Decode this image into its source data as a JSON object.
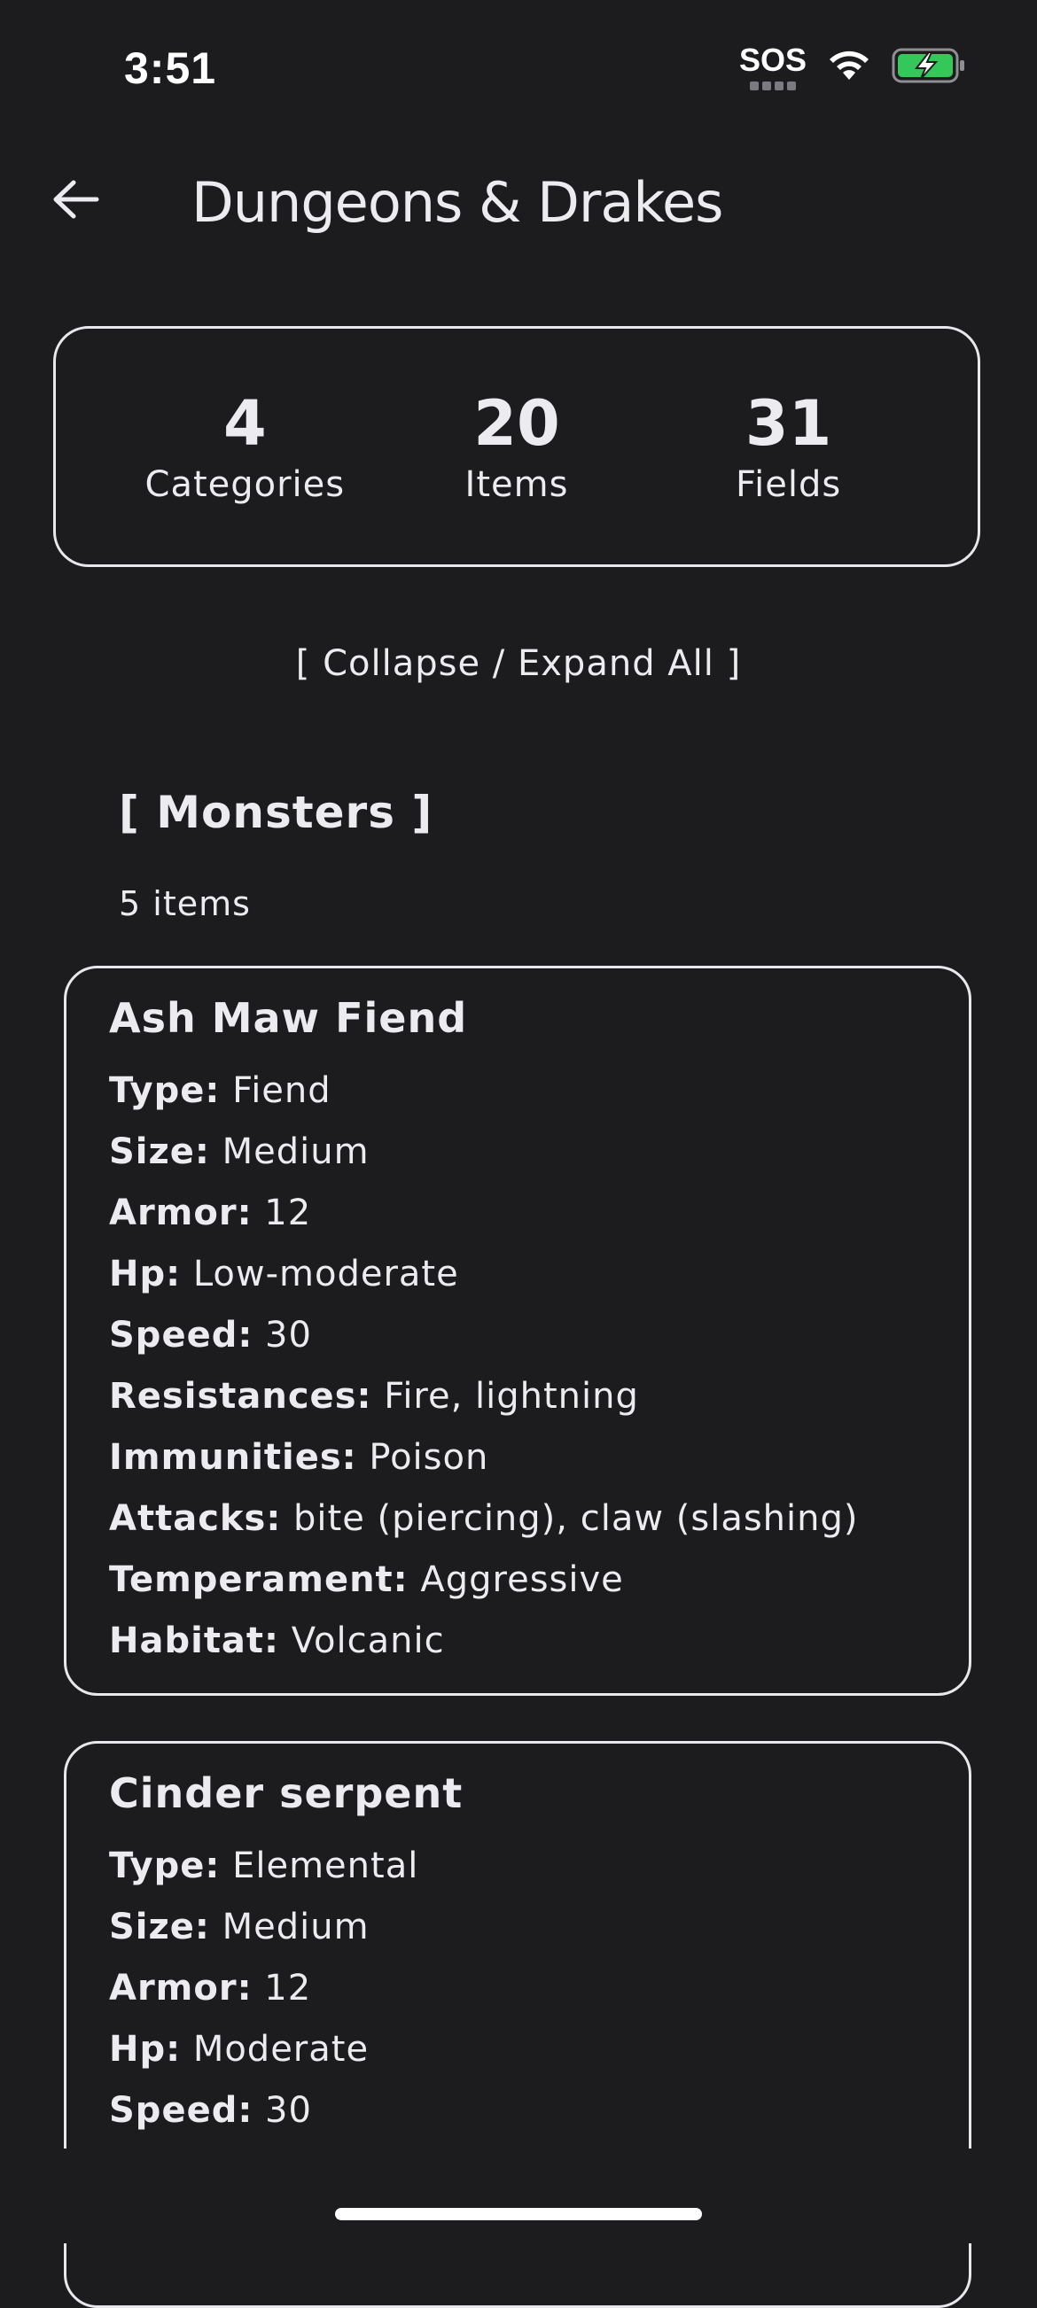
{
  "status": {
    "time": "3:51",
    "sos": "SOS",
    "colors": {
      "battery": "#34c759"
    }
  },
  "header": {
    "title": "Dungeons & Drakes"
  },
  "stats": [
    {
      "value": "4",
      "label": "Categories"
    },
    {
      "value": "20",
      "label": "Items"
    },
    {
      "value": "31",
      "label": "Fields"
    }
  ],
  "collapse_label": "[ Collapse / Expand All ]",
  "section": {
    "title": "[ Monsters ]",
    "count": "5 items",
    "items": [
      {
        "name": "Ash Maw Fiend",
        "fields": [
          {
            "key": "Type:",
            "value": " Fiend"
          },
          {
            "key": "Size:",
            "value": " Medium"
          },
          {
            "key": "Armor:",
            "value": " 12"
          },
          {
            "key": "Hp:",
            "value": " Low-moderate"
          },
          {
            "key": "Speed:",
            "value": " 30"
          },
          {
            "key": "Resistances:",
            "value": " Fire, lightning"
          },
          {
            "key": "Immunities:",
            "value": " Poison"
          },
          {
            "key": "Attacks:",
            "value": " bite (piercing), claw (slashing)"
          },
          {
            "key": "Temperament:",
            "value": " Aggressive"
          },
          {
            "key": "Habitat:",
            "value": " Volcanic"
          }
        ]
      },
      {
        "name": "Cinder serpent",
        "fields": [
          {
            "key": "Type:",
            "value": " Elemental"
          },
          {
            "key": "Size:",
            "value": " Medium"
          },
          {
            "key": "Armor:",
            "value": " 12"
          },
          {
            "key": "Hp:",
            "value": " Moderate"
          },
          {
            "key": "Speed:",
            "value": " 30"
          }
        ]
      }
    ]
  }
}
